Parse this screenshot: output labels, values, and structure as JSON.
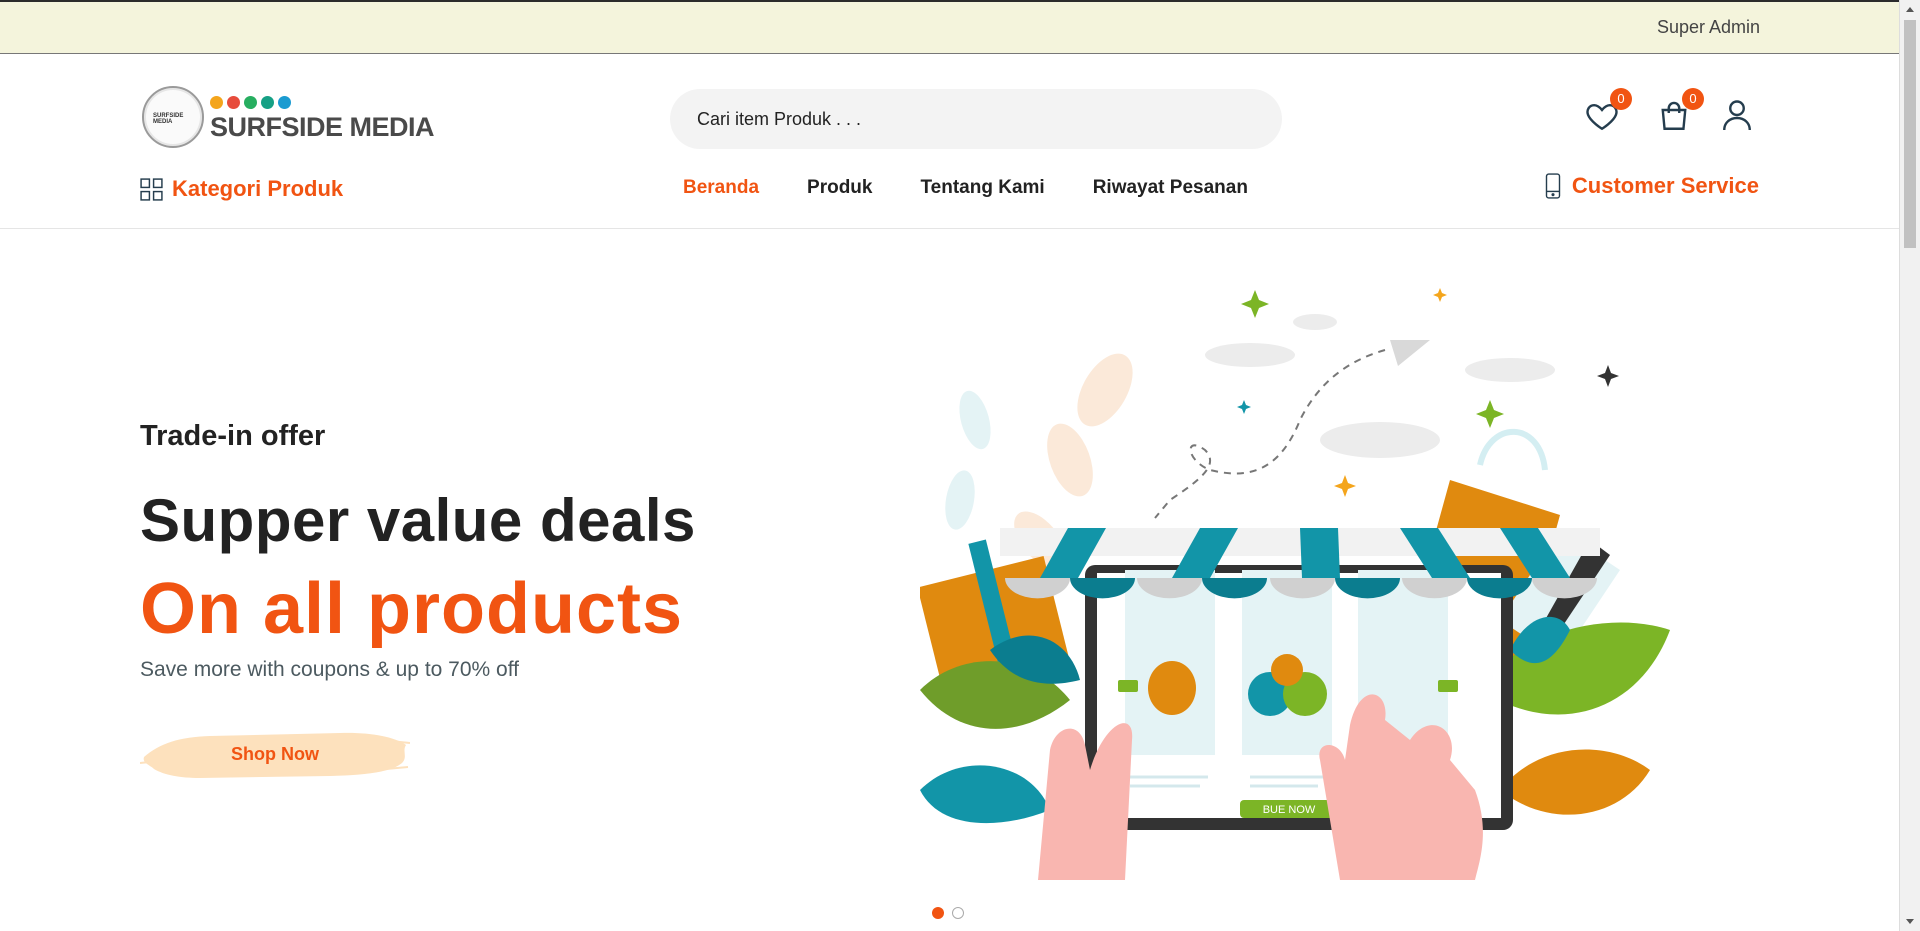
{
  "topbar": {
    "user": "Super Admin"
  },
  "logo": {
    "badge_text": "SURFSIDE MEDIA",
    "wordmark": "SURFSIDE MEDIA",
    "dot_colors": [
      "#f4a51c",
      "#e74c3c",
      "#27ae60",
      "#16a085",
      "#1b9bd1"
    ]
  },
  "search": {
    "placeholder": "Cari item Produk . . ."
  },
  "wishlist": {
    "icon": "heart-icon",
    "count": "0"
  },
  "cart": {
    "icon": "shopping-bag-icon",
    "count": "0"
  },
  "account": {
    "icon": "user-icon"
  },
  "category": {
    "icon": "grid-icon",
    "label": "Kategori Produk"
  },
  "nav": {
    "items": [
      {
        "label": "Beranda",
        "active": true
      },
      {
        "label": "Produk"
      },
      {
        "label": "Tentang Kami"
      },
      {
        "label": "Riwayat Pesanan"
      }
    ]
  },
  "customer_service": {
    "icon": "phone-icon",
    "label": "Customer Service"
  },
  "hero": {
    "subtitle": "Trade-in offer",
    "title": "Supper value deals",
    "highlight": "On all products",
    "description": "Save more with coupons & up to 70% off",
    "button": "Shop Now",
    "illustration_buy_label": "BUE NOW"
  },
  "slider": {
    "slides": 2,
    "active": 1
  },
  "colors": {
    "accent": "#f15412",
    "topbar_bg": "#f4f4dc",
    "text_dark": "#222222",
    "teal": "#1295a8"
  }
}
